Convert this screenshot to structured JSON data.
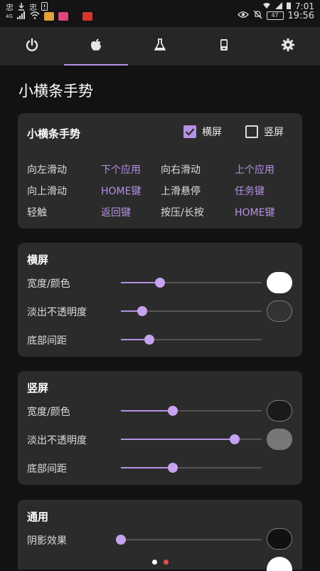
{
  "status_bar": {
    "time_small": "7:01",
    "time": "19:56",
    "battery": "47",
    "network": "4G",
    "left_glyph": "忠",
    "left_glyph2": "忠",
    "icons": [
      "download-icon",
      "alert-icon",
      "signal-icon",
      "wifi-icon",
      "eye-icon",
      "mute-icon",
      "battery-icon"
    ]
  },
  "tabs": [
    {
      "icon": "power-icon",
      "active": false
    },
    {
      "icon": "apple-icon",
      "active": true
    },
    {
      "icon": "flask-icon",
      "active": false
    },
    {
      "icon": "phone-icon",
      "active": false
    },
    {
      "icon": "gear-icon",
      "active": false
    }
  ],
  "page_title": "小横条手势",
  "gesture_card": {
    "title": "小横条手势",
    "landscape_label": "横屏",
    "landscape_checked": true,
    "portrait_label": "竖屏",
    "portrait_checked": false,
    "gestures": [
      {
        "label": "向左滑动",
        "value": "下个应用"
      },
      {
        "label": "向右滑动",
        "value": "上个应用"
      },
      {
        "label": "向上滑动",
        "value": "HOME键"
      },
      {
        "label": "上滑悬停",
        "value": "任务键"
      },
      {
        "label": "轻触",
        "value": "返回键"
      },
      {
        "label": "按压/长按",
        "value": "HOME键"
      }
    ]
  },
  "landscape_card": {
    "title": "横屏",
    "rows": [
      {
        "label": "宽度/颜色",
        "value": 0.28,
        "swatch": "#ffffff"
      },
      {
        "label": "淡出不透明度",
        "value": 0.15,
        "swatch": "#333333"
      },
      {
        "label": "底部间距",
        "value": 0.2
      }
    ]
  },
  "portrait_card": {
    "title": "竖屏",
    "rows": [
      {
        "label": "宽度/颜色",
        "value": 0.37,
        "swatch": "#1a1a1a"
      },
      {
        "label": "淡出不透明度",
        "value": 0.81,
        "swatch": "#777777"
      },
      {
        "label": "底部间距",
        "value": 0.37
      }
    ]
  },
  "general_card": {
    "title": "通用",
    "rows": [
      {
        "label": "阴影效果",
        "value": 0.0,
        "swatch": "#111111"
      }
    ]
  },
  "colors": {
    "accent": "#b591e6",
    "background": "#121212",
    "card": "#2b2b2b",
    "tabbar": "#262626"
  },
  "pager": {
    "pages": 2,
    "current": 0
  }
}
